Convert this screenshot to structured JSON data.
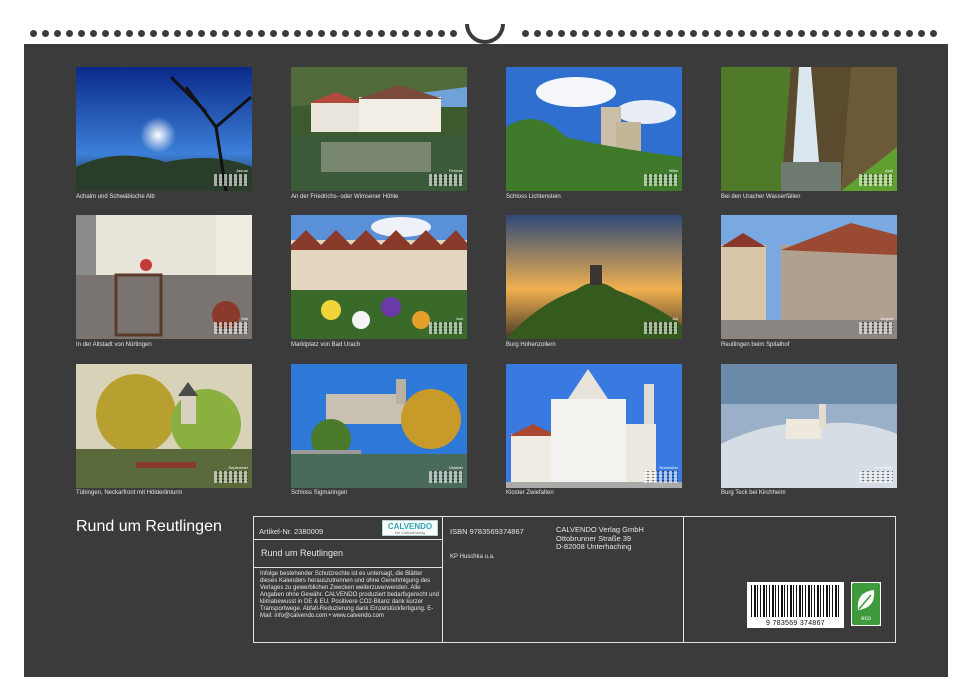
{
  "calendar": {
    "title": "Rund um Reutlingen"
  },
  "months": [
    {
      "month": "Januar",
      "caption": "Achalm und Schwäbische Alb"
    },
    {
      "month": "Februar",
      "caption": "An der Friedrichs- oder Wimsener Höhle"
    },
    {
      "month": "März",
      "caption": "Schloss Lichtenstein"
    },
    {
      "month": "April",
      "caption": "Bei den Uracher Wasserfällen"
    },
    {
      "month": "Mai",
      "caption": "In der Altstadt von Nürtingen"
    },
    {
      "month": "Juni",
      "caption": "Marktplatz von Bad Urach"
    },
    {
      "month": "Juli",
      "caption": "Burg Hohenzollern"
    },
    {
      "month": "August",
      "caption": "Reutlingen beim Spitalhof"
    },
    {
      "month": "September",
      "caption": "Tübingen, Neckarfront mit Hölderlinturm"
    },
    {
      "month": "Oktober",
      "caption": "Schloss Sigmaringen"
    },
    {
      "month": "November",
      "caption": "Kloster Zwiefalten"
    },
    {
      "month": "Dezember",
      "caption": "Burg Teck bei Kirchheim"
    }
  ],
  "info": {
    "article": "Artikel-Nr. 2380009",
    "isbn": "ISBN 9783569374867",
    "publisher_lines": [
      "CALVENDO Verlag GmbH",
      "Ottobrunner Straße 39",
      "D-82008 Unterhaching"
    ],
    "subtitle": "Rund um Reutlingen",
    "author": "KP Huschka u.a.",
    "legal": "Infolge bestehender Schutzrechte ist es untersagt, die Blätter dieses Kalenders herauszutrennen und ohne Genehmigung des Verlages zu gewerblichen Zwecken weiterzuverwenden. Alle Angaben ohne Gewähr. CALVENDO produziert bedarfsgerecht und klimabewusst in DE & EU. Positivere CO2-Bilanz dank kurzer Transportwege. Abfall-Reduzierung dank Einzelstückfertigung. E-Mail: info@calvendo.com • www.calvendo.com",
    "logo_main": "CALVENDO",
    "logo_sub": "Der Kalenderverlag",
    "barcode_number": "9 783569 374867",
    "eco_label": "eco"
  },
  "colors": {
    "background": "#3b3b3b",
    "accent": "#2aa5b5",
    "eco_green": "#3e9a3a"
  }
}
